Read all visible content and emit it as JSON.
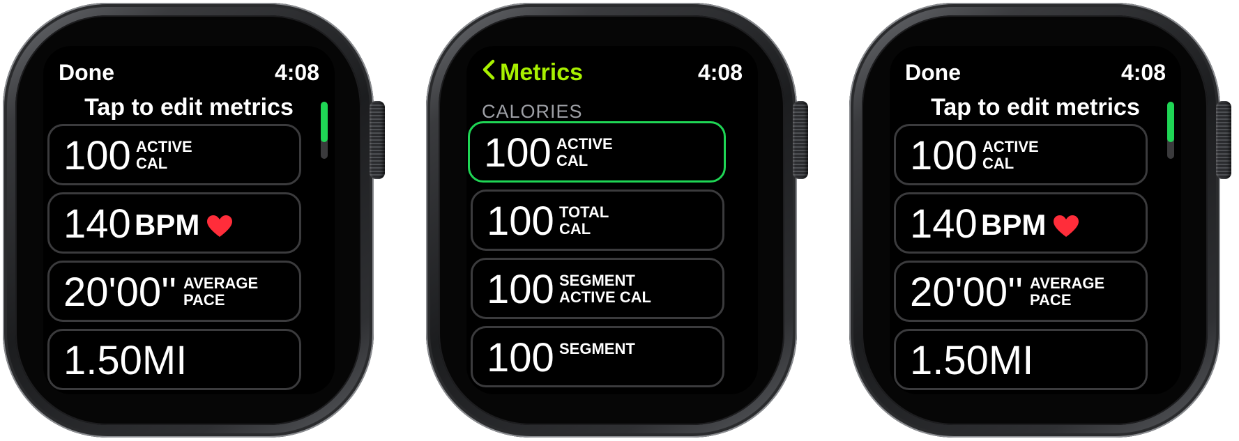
{
  "watches": [
    {
      "status": {
        "left_label": "Done",
        "time": "4:08"
      },
      "heading": "Tap to edit metrics",
      "rows": [
        {
          "value": "100",
          "label": "ACTIVE\nCAL"
        },
        {
          "value": "140",
          "label": "BPM"
        },
        {
          "value": "20'00''",
          "label": "AVERAGE\nPACE"
        },
        {
          "value": "1.50MI",
          "label": ""
        }
      ]
    },
    {
      "status": {
        "back_label": "Metrics",
        "time": "4:08"
      },
      "section": "CALORIES",
      "rows": [
        {
          "value": "100",
          "label": "ACTIVE\nCAL",
          "selected": true
        },
        {
          "value": "100",
          "label": "TOTAL\nCAL"
        },
        {
          "value": "100",
          "label": "SEGMENT\nACTIVE CAL"
        },
        {
          "value": "100",
          "label": "SEGMENT"
        }
      ]
    },
    {
      "status": {
        "left_label": "Done",
        "time": "4:08"
      },
      "heading": "Tap to edit metrics",
      "rows": [
        {
          "value": "100",
          "label": "ACTIVE\nCAL"
        },
        {
          "value": "140",
          "label": "BPM"
        },
        {
          "value": "20'00''",
          "label": "AVERAGE\nPACE"
        },
        {
          "value": "1.50MI",
          "label": ""
        }
      ]
    }
  ],
  "colors": {
    "accent_green": "#1fd655",
    "back_link": "#a8f000",
    "heart": "#ff2d3a"
  },
  "icons": [
    "chevron-left-icon",
    "heart-icon"
  ]
}
